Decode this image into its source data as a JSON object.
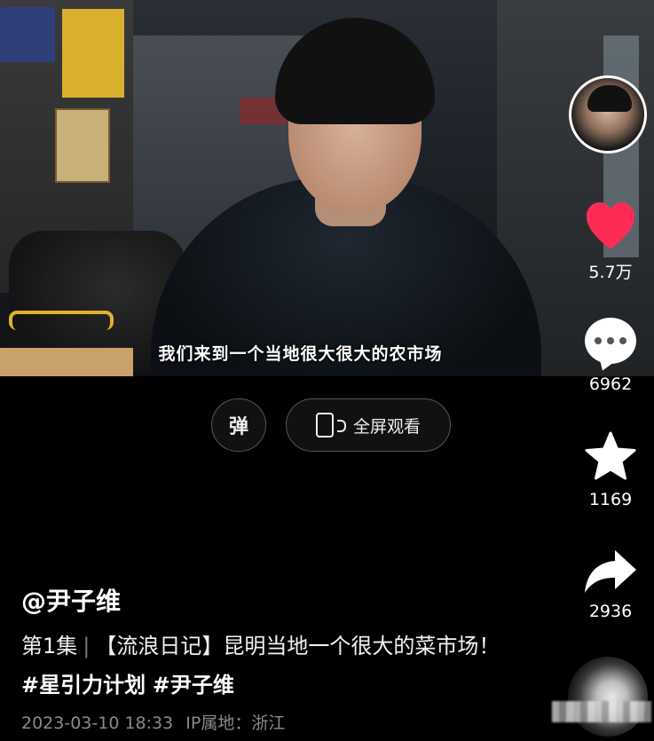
{
  "video": {
    "subtitle": "我们来到一个当地很大很大的农市场"
  },
  "controls": {
    "danmu_label": "弹",
    "fullscreen_label": "全屏观看"
  },
  "rail": {
    "likes": "5.7万",
    "comments": "6962",
    "favorites": "1169",
    "shares": "2936",
    "like_color": "#fe2c55"
  },
  "post": {
    "author": "@尹子维",
    "episode": "第1集",
    "title": "【流浪日记】昆明当地一个很大的菜市场！",
    "hashtags": [
      "#星引力计划",
      "#尹子维"
    ],
    "date": "2023-03-10 18:33",
    "ip_location": "IP属地：浙江"
  }
}
